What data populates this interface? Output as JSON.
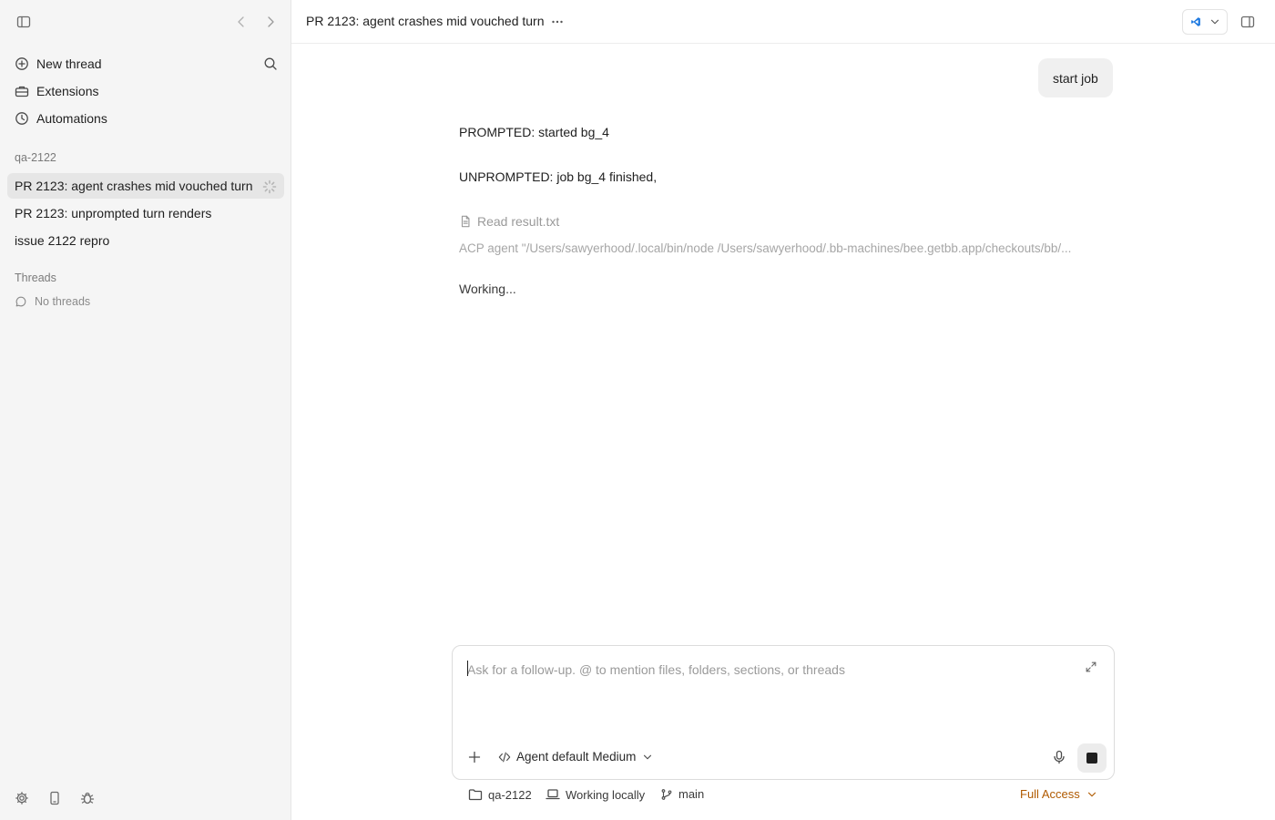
{
  "sidebar": {
    "nav": [
      {
        "label": "New thread",
        "icon": "plus-circle-icon"
      },
      {
        "label": "Extensions",
        "icon": "toolbox-icon"
      },
      {
        "label": "Automations",
        "icon": "clock-icon"
      }
    ],
    "project": {
      "name": "qa-2122",
      "threads": [
        {
          "label": "PR 2123: agent crashes mid vouched turn",
          "active": true
        },
        {
          "label": "PR 2123: unprompted turn renders",
          "active": false
        },
        {
          "label": "issue 2122 repro",
          "active": false
        }
      ]
    },
    "threads_section": {
      "title": "Threads",
      "empty_text": "No threads"
    }
  },
  "header": {
    "title": "PR 2123: agent crashes mid vouched turn"
  },
  "conversation": {
    "user_message": "start job",
    "messages": [
      "PROMPTED: started bg_4",
      "UNPROMPTED: job bg_4 finished,"
    ],
    "tool_call": "Read result.txt",
    "agent_command": "ACP agent \"/Users/sawyerhood/.local/bin/node /Users/sawyerhood/.bb-machines/bee.getbb.app/checkouts/bb/...",
    "status": "Working..."
  },
  "composer": {
    "placeholder": "Ask for a follow-up. @ to mention files, folders, sections, or threads",
    "model_label": "Agent default Medium"
  },
  "footer": {
    "folder": "qa-2122",
    "environment": "Working locally",
    "branch": "main",
    "access": "Full Access"
  },
  "colors": {
    "accent_warning": "#b05a00",
    "editor_blue": "#1f7ae0"
  }
}
